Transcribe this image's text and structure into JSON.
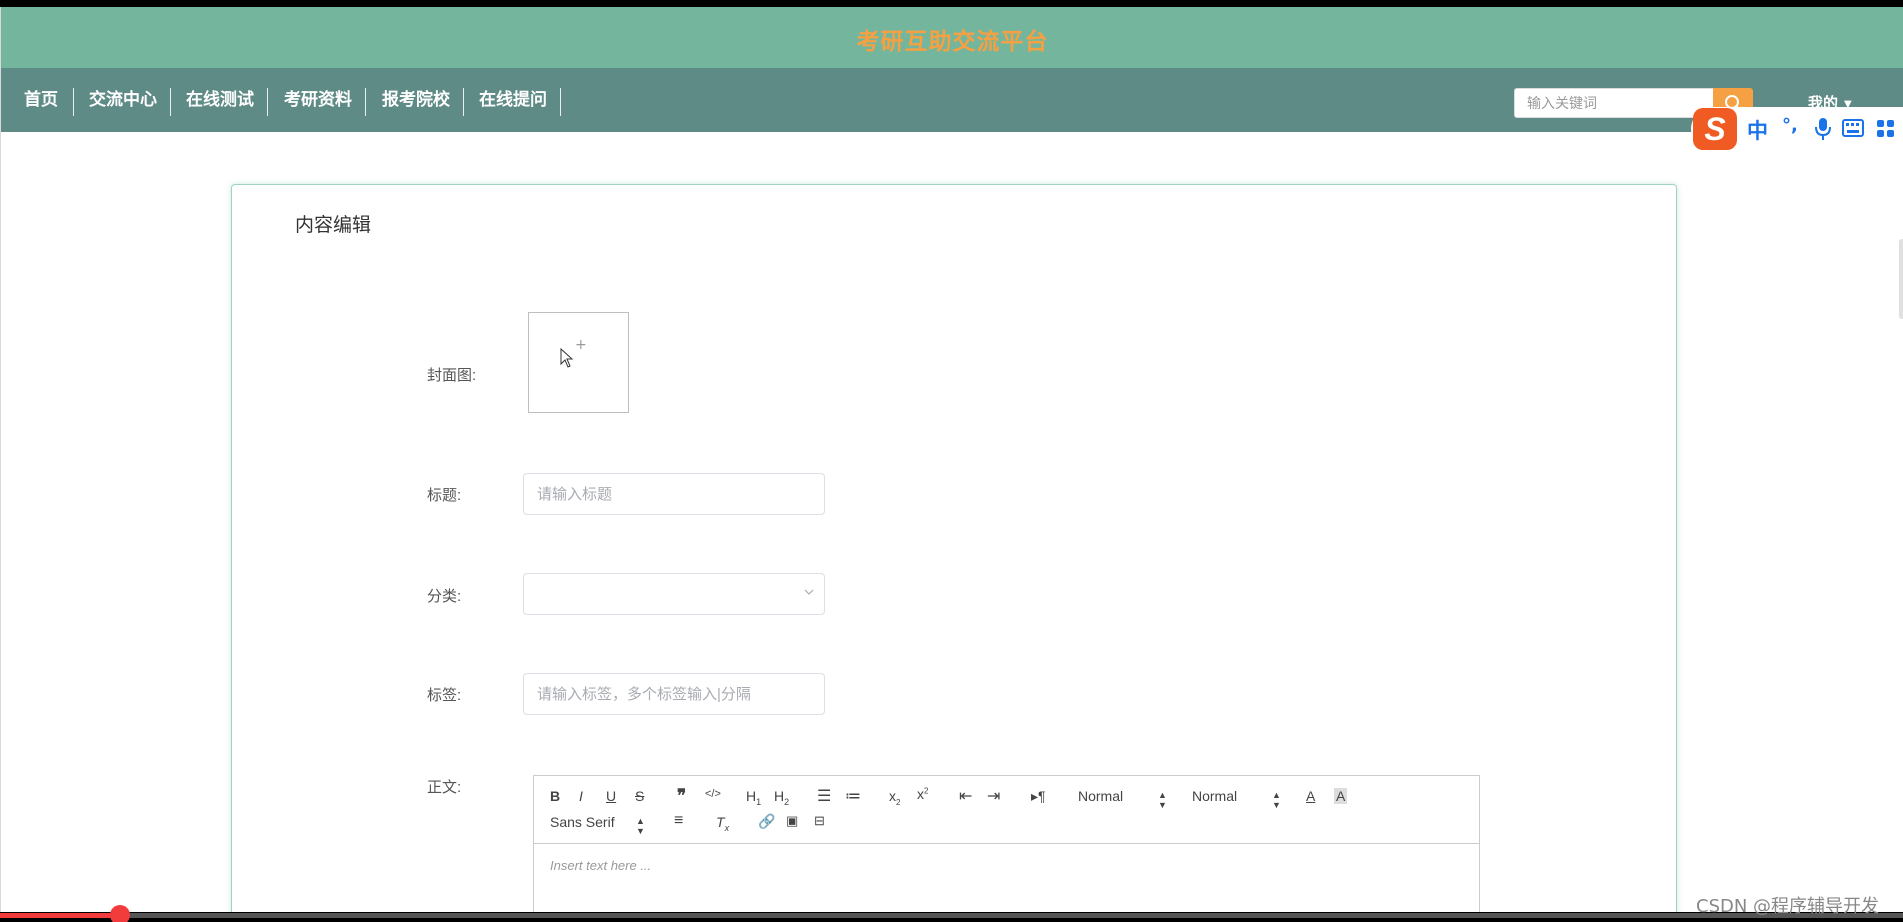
{
  "header": {
    "site_title": "考研互助交流平台"
  },
  "nav": {
    "items": [
      {
        "label": "首页"
      },
      {
        "label": "交流中心"
      },
      {
        "label": "在线测试"
      },
      {
        "label": "考研资料"
      },
      {
        "label": "报考院校"
      },
      {
        "label": "在线提问"
      }
    ],
    "search_placeholder": "输入关键词",
    "user_menu": "我的"
  },
  "ime": {
    "logo": "S",
    "mode": "中",
    "punct": "°,"
  },
  "form": {
    "card_title": "内容编辑",
    "cover_label": "封面图:",
    "title_label": "标题:",
    "title_placeholder": "请输入标题",
    "category_label": "分类:",
    "category_value": "",
    "tags_label": "标签:",
    "tags_placeholder": "请输入标签，多个标签输入|分隔",
    "body_label": "正文:"
  },
  "editor": {
    "header_picker": "Normal",
    "size_picker": "Normal",
    "font_picker": "Sans Serif",
    "placeholder": "Insert text here ..."
  },
  "video": {
    "progress": 0.063
  },
  "watermark": "CSDN @程序辅导开发",
  "colors": {
    "banner": "#74b69d",
    "navbar": "#5f8b87",
    "accent": "#f5a042"
  }
}
